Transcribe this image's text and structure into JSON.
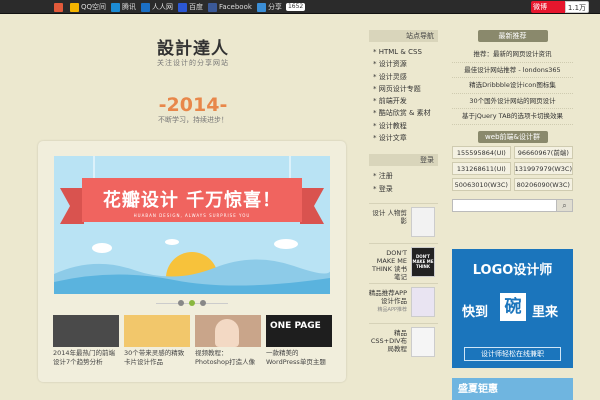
{
  "topbar": {
    "share": [
      {
        "label": "",
        "icon": "renren-icon",
        "color": "#e25a3a"
      },
      {
        "label": "QQ空间",
        "icon": "qzone-icon",
        "color": "#f4b400"
      },
      {
        "label": "腾讯",
        "icon": "tencent-icon",
        "color": "#1c8bd4"
      },
      {
        "label": "人人网",
        "icon": "renren-icon",
        "color": "#1b6fc4"
      },
      {
        "label": "百度",
        "icon": "baidu-icon",
        "color": "#2b57d4"
      },
      {
        "label": "Facebook",
        "icon": "facebook-icon",
        "color": "#3b5998"
      },
      {
        "label": "分享",
        "icon": "plus-icon",
        "color": "#3b8ed6",
        "count": "1652"
      }
    ],
    "weibo_label": "微博",
    "weibo_count": "1.1万"
  },
  "header": {
    "title": "設計達人",
    "subtitle": "关注设计的分享网站",
    "year": "-2014-",
    "year_sub": "不断学习，持续进步！"
  },
  "slider": {
    "banner_title": "花瓣设计  千万惊喜！",
    "banner_small": "HUABAN DESIGN, ALWAYS SURPRISE YOU",
    "dots": [
      false,
      true,
      false
    ],
    "thumbs": [
      {
        "caption": "2014年最热门的前端设计7个趋势分析",
        "color": "#4a4a4a"
      },
      {
        "caption": "30个带来灵感的精致卡片设计作品",
        "color": "#f2c76b"
      },
      {
        "caption": "视频教程：Photoshop打造人像",
        "color": "#c9a58a"
      },
      {
        "caption": "一款精美的WordPress单页主题",
        "color": "#1e1e1e"
      }
    ],
    "thumb_text": "ONE PAGE"
  },
  "mid": {
    "nav_title": "站点导航",
    "nav_items": [
      "* HTML & CSS",
      "* 设计资源",
      "* 设计灵感",
      "* 网页设计专题",
      "* 前端开发",
      "* 酷站欣赏 & 素材",
      "* 设计教程",
      "* 设计文章"
    ],
    "login_title": "登录",
    "login_items": [
      "* 注册",
      "* 登录"
    ],
    "posts": [
      {
        "title": "设计 人物剪影",
        "date": ""
      },
      {
        "title": "DON'T MAKE ME THINK 读书笔记",
        "date": ""
      },
      {
        "title": "精品推荐APP设计作品",
        "date": "精品APP推荐"
      },
      {
        "title": "精品CSS+DIV布局教程",
        "date": ""
      }
    ],
    "book_text": "DON'T MAKE ME THINK"
  },
  "right": {
    "links": [
      "推荐：最新的网页设计资讯",
      "最佳设计网站推荐 - londons365",
      "精选Dribbble设计icon图标集",
      "30个国外设计网站的网页设计",
      "基于jQuery TAB的选项卡切换效果"
    ],
    "qq_title": "web前端&设计群",
    "qq": [
      "155595864(UI)",
      "96660967(前端)",
      "131268611(UI)",
      "131997979(W3C)",
      "50063010(W3C)",
      "80206090(W3C)"
    ],
    "search_placeholder": "",
    "ad_title": "LOGO设计师",
    "ad_line1": "快到",
    "ad_mid": "碗",
    "ad_line2": "里来",
    "ad_sub": "设计师轻松在线兼职",
    "ad2_text": "盛夏钜惠"
  }
}
